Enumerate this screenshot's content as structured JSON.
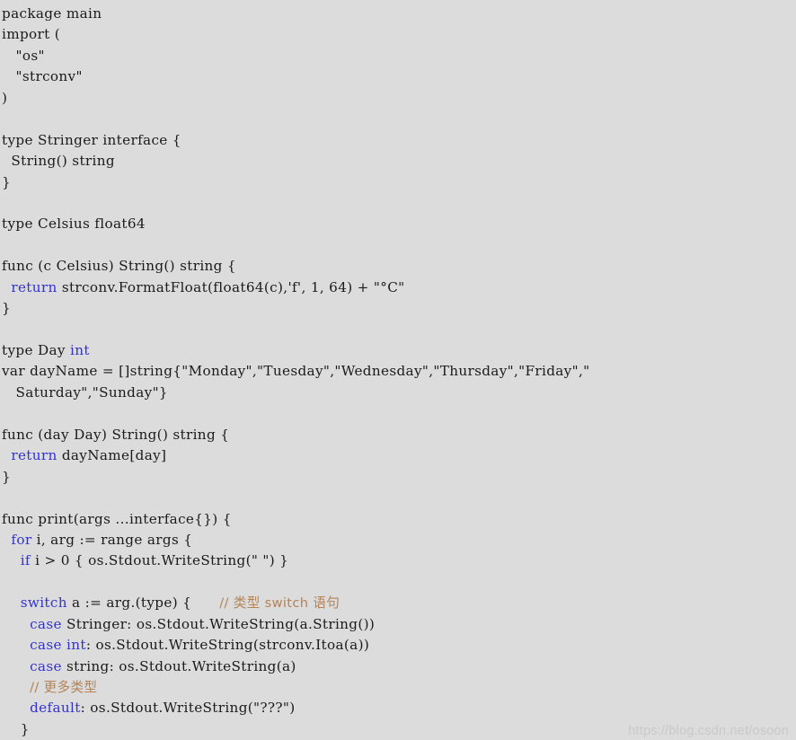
{
  "document": {
    "language": "Go",
    "background_color": "#dcdcdc",
    "text_color": "#1a1a1a",
    "keyword_color": "#3333cc",
    "comment_color": "#b58357",
    "watermark_color": "#c9c9c9"
  },
  "watermark": {
    "text": "https://blog.csdn.net/osoon"
  },
  "code": {
    "lines": [
      {
        "id": 1,
        "tokens": [
          {
            "t": "plain",
            "s": "package main"
          }
        ]
      },
      {
        "id": 2,
        "tokens": [
          {
            "t": "plain",
            "s": "import ("
          }
        ]
      },
      {
        "id": 3,
        "tokens": [
          {
            "t": "plain",
            "s": "   \"os\""
          }
        ]
      },
      {
        "id": 4,
        "tokens": [
          {
            "t": "plain",
            "s": "   \"strconv\""
          }
        ]
      },
      {
        "id": 5,
        "tokens": [
          {
            "t": "plain",
            "s": ")"
          }
        ]
      },
      {
        "id": 6,
        "tokens": []
      },
      {
        "id": 7,
        "tokens": [
          {
            "t": "plain",
            "s": "type Stringer interface {"
          }
        ]
      },
      {
        "id": 8,
        "tokens": [
          {
            "t": "plain",
            "s": "  String() string"
          }
        ]
      },
      {
        "id": 9,
        "tokens": [
          {
            "t": "plain",
            "s": "}"
          }
        ]
      },
      {
        "id": 10,
        "tokens": []
      },
      {
        "id": 11,
        "tokens": [
          {
            "t": "plain",
            "s": "type Celsius float64"
          }
        ]
      },
      {
        "id": 12,
        "tokens": []
      },
      {
        "id": 13,
        "tokens": [
          {
            "t": "plain",
            "s": "func (c Celsius) String() string {"
          }
        ]
      },
      {
        "id": 14,
        "tokens": [
          {
            "t": "plain",
            "s": "  "
          },
          {
            "t": "kw",
            "s": "return"
          },
          {
            "t": "plain",
            "s": " strconv.FormatFloat(float64(c),'f', 1, 64) + \"°C\""
          }
        ]
      },
      {
        "id": 15,
        "tokens": [
          {
            "t": "plain",
            "s": "}"
          }
        ]
      },
      {
        "id": 16,
        "tokens": []
      },
      {
        "id": 17,
        "tokens": [
          {
            "t": "plain",
            "s": "type Day "
          },
          {
            "t": "kw",
            "s": "int"
          }
        ]
      },
      {
        "id": 18,
        "tokens": [
          {
            "t": "plain",
            "s": "var dayName = []string{\"Monday\",\"Tuesday\",\"Wednesday\",\"Thursday\",\"Friday\",\""
          }
        ]
      },
      {
        "id": 19,
        "tokens": [
          {
            "t": "plain",
            "s": "   Saturday\",\"Sunday\"}"
          }
        ]
      },
      {
        "id": 20,
        "tokens": []
      },
      {
        "id": 21,
        "tokens": [
          {
            "t": "plain",
            "s": "func (day Day) String() string {"
          }
        ]
      },
      {
        "id": 22,
        "tokens": [
          {
            "t": "plain",
            "s": "  "
          },
          {
            "t": "kw",
            "s": "return"
          },
          {
            "t": "plain",
            "s": " dayName[day]"
          }
        ]
      },
      {
        "id": 23,
        "tokens": [
          {
            "t": "plain",
            "s": "}"
          }
        ]
      },
      {
        "id": 24,
        "tokens": []
      },
      {
        "id": 25,
        "tokens": [
          {
            "t": "plain",
            "s": "func print(args ...interface{}) {"
          }
        ]
      },
      {
        "id": 26,
        "tokens": [
          {
            "t": "plain",
            "s": "  "
          },
          {
            "t": "kw",
            "s": "for"
          },
          {
            "t": "plain",
            "s": " i, arg := range args {"
          }
        ]
      },
      {
        "id": 27,
        "tokens": [
          {
            "t": "plain",
            "s": "    "
          },
          {
            "t": "kw",
            "s": "if"
          },
          {
            "t": "plain",
            "s": " i > 0 { os.Stdout.WriteString(\" \") }"
          }
        ]
      },
      {
        "id": 28,
        "tokens": []
      },
      {
        "id": 29,
        "tokens": [
          {
            "t": "plain",
            "s": "    "
          },
          {
            "t": "kw",
            "s": "switch"
          },
          {
            "t": "plain",
            "s": " a := arg.(type) {      "
          },
          {
            "t": "cmt",
            "s": "// 类型 switch 语句"
          }
        ]
      },
      {
        "id": 30,
        "tokens": [
          {
            "t": "plain",
            "s": "      "
          },
          {
            "t": "kw",
            "s": "case"
          },
          {
            "t": "plain",
            "s": " Stringer: os.Stdout.WriteString(a.String())"
          }
        ]
      },
      {
        "id": 31,
        "tokens": [
          {
            "t": "plain",
            "s": "      "
          },
          {
            "t": "kw",
            "s": "case"
          },
          {
            "t": "plain",
            "s": " "
          },
          {
            "t": "kw",
            "s": "int"
          },
          {
            "t": "plain",
            "s": ": os.Stdout.WriteString(strconv.Itoa(a))"
          }
        ]
      },
      {
        "id": 32,
        "tokens": [
          {
            "t": "plain",
            "s": "      "
          },
          {
            "t": "kw",
            "s": "case"
          },
          {
            "t": "plain",
            "s": " string: os.Stdout.WriteString(a)"
          }
        ]
      },
      {
        "id": 33,
        "tokens": [
          {
            "t": "plain",
            "s": "      "
          },
          {
            "t": "cmt",
            "s": "// 更多类型"
          }
        ]
      },
      {
        "id": 34,
        "tokens": [
          {
            "t": "plain",
            "s": "      "
          },
          {
            "t": "kw",
            "s": "default"
          },
          {
            "t": "plain",
            "s": ": os.Stdout.WriteString(\"???\")"
          }
        ]
      },
      {
        "id": 35,
        "tokens": [
          {
            "t": "plain",
            "s": "    }"
          }
        ]
      }
    ]
  }
}
